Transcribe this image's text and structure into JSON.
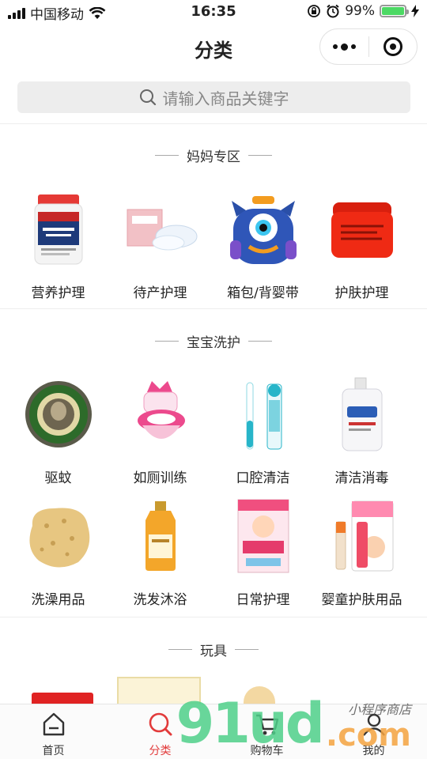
{
  "status_bar": {
    "carrier": "中国移动",
    "time": "16:35",
    "battery": "99%",
    "battery_level": 0.99
  },
  "nav": {
    "title": "分类"
  },
  "search": {
    "placeholder": "请输入商品关键字"
  },
  "sections": [
    {
      "title": "妈妈专区",
      "items": [
        "营养护理",
        "待产护理",
        "箱包/背婴带",
        "护肤护理"
      ]
    },
    {
      "title": "宝宝洗护",
      "items": [
        "驱蚊",
        "如厕训练",
        "口腔清洁",
        "清洁消毒",
        "洗澡用品",
        "洗发沐浴",
        "日常护理",
        "婴童护肤用品"
      ]
    },
    {
      "title": "玩具",
      "items": []
    }
  ],
  "tab_bar": {
    "tabs": [
      "首页",
      "分类",
      "购物车",
      "我的"
    ],
    "active": "分类"
  },
  "watermark": {
    "main": "91ud",
    "suffix": ".com",
    "small": "小程序商店"
  },
  "colors": {
    "accent": "#e23b3b",
    "search_bg": "#ededed",
    "battery": "#4cd964"
  }
}
